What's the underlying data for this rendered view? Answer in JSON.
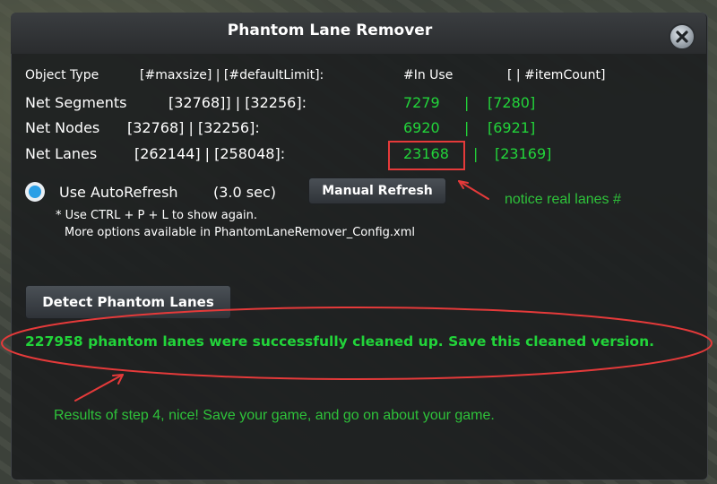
{
  "window": {
    "title": "Phantom Lane Remover",
    "close_icon": "close-icon"
  },
  "headers": {
    "object_type": "Object Type",
    "maxsize_default": "[#maxsize]  |  [#defaultLimit]:",
    "in_use": "#In Use",
    "item_count": "[   |  #itemCount]"
  },
  "rows": [
    {
      "label": "Net Segments",
      "limits": "[32768]]  |  [32256]:",
      "in_use": "7279",
      "sep": "|",
      "item_count": "[7280]"
    },
    {
      "label": "Net Nodes",
      "limits": "[32768]  |  [32256]:",
      "in_use": "6920",
      "sep": "|",
      "item_count": "[6921]"
    },
    {
      "label": "Net Lanes",
      "limits": "[262144]  |  [258048]:",
      "in_use": "23168",
      "sep": "|",
      "item_count": "[23169]"
    }
  ],
  "autorefresh": {
    "label": "Use AutoRefresh",
    "interval": "(3.0 sec)",
    "checked": true
  },
  "buttons": {
    "manual_refresh": "Manual Refresh",
    "detect": "Detect Phantom Lanes"
  },
  "hints": {
    "line1": "* Use CTRL + P + L to show again.",
    "line2": "More options available in PhantomLaneRemover_Config.xml"
  },
  "result": "227958 phantom lanes were successfully cleaned up. Save this cleaned version.",
  "annotations": {
    "notice": "notice real lanes #",
    "results": "Results of step 4, nice!   Save your game, and go on about your game."
  },
  "colors": {
    "accent_green": "#22d43a",
    "annotation_red": "#e53a3a",
    "radio_blue": "#2a9fe6"
  }
}
